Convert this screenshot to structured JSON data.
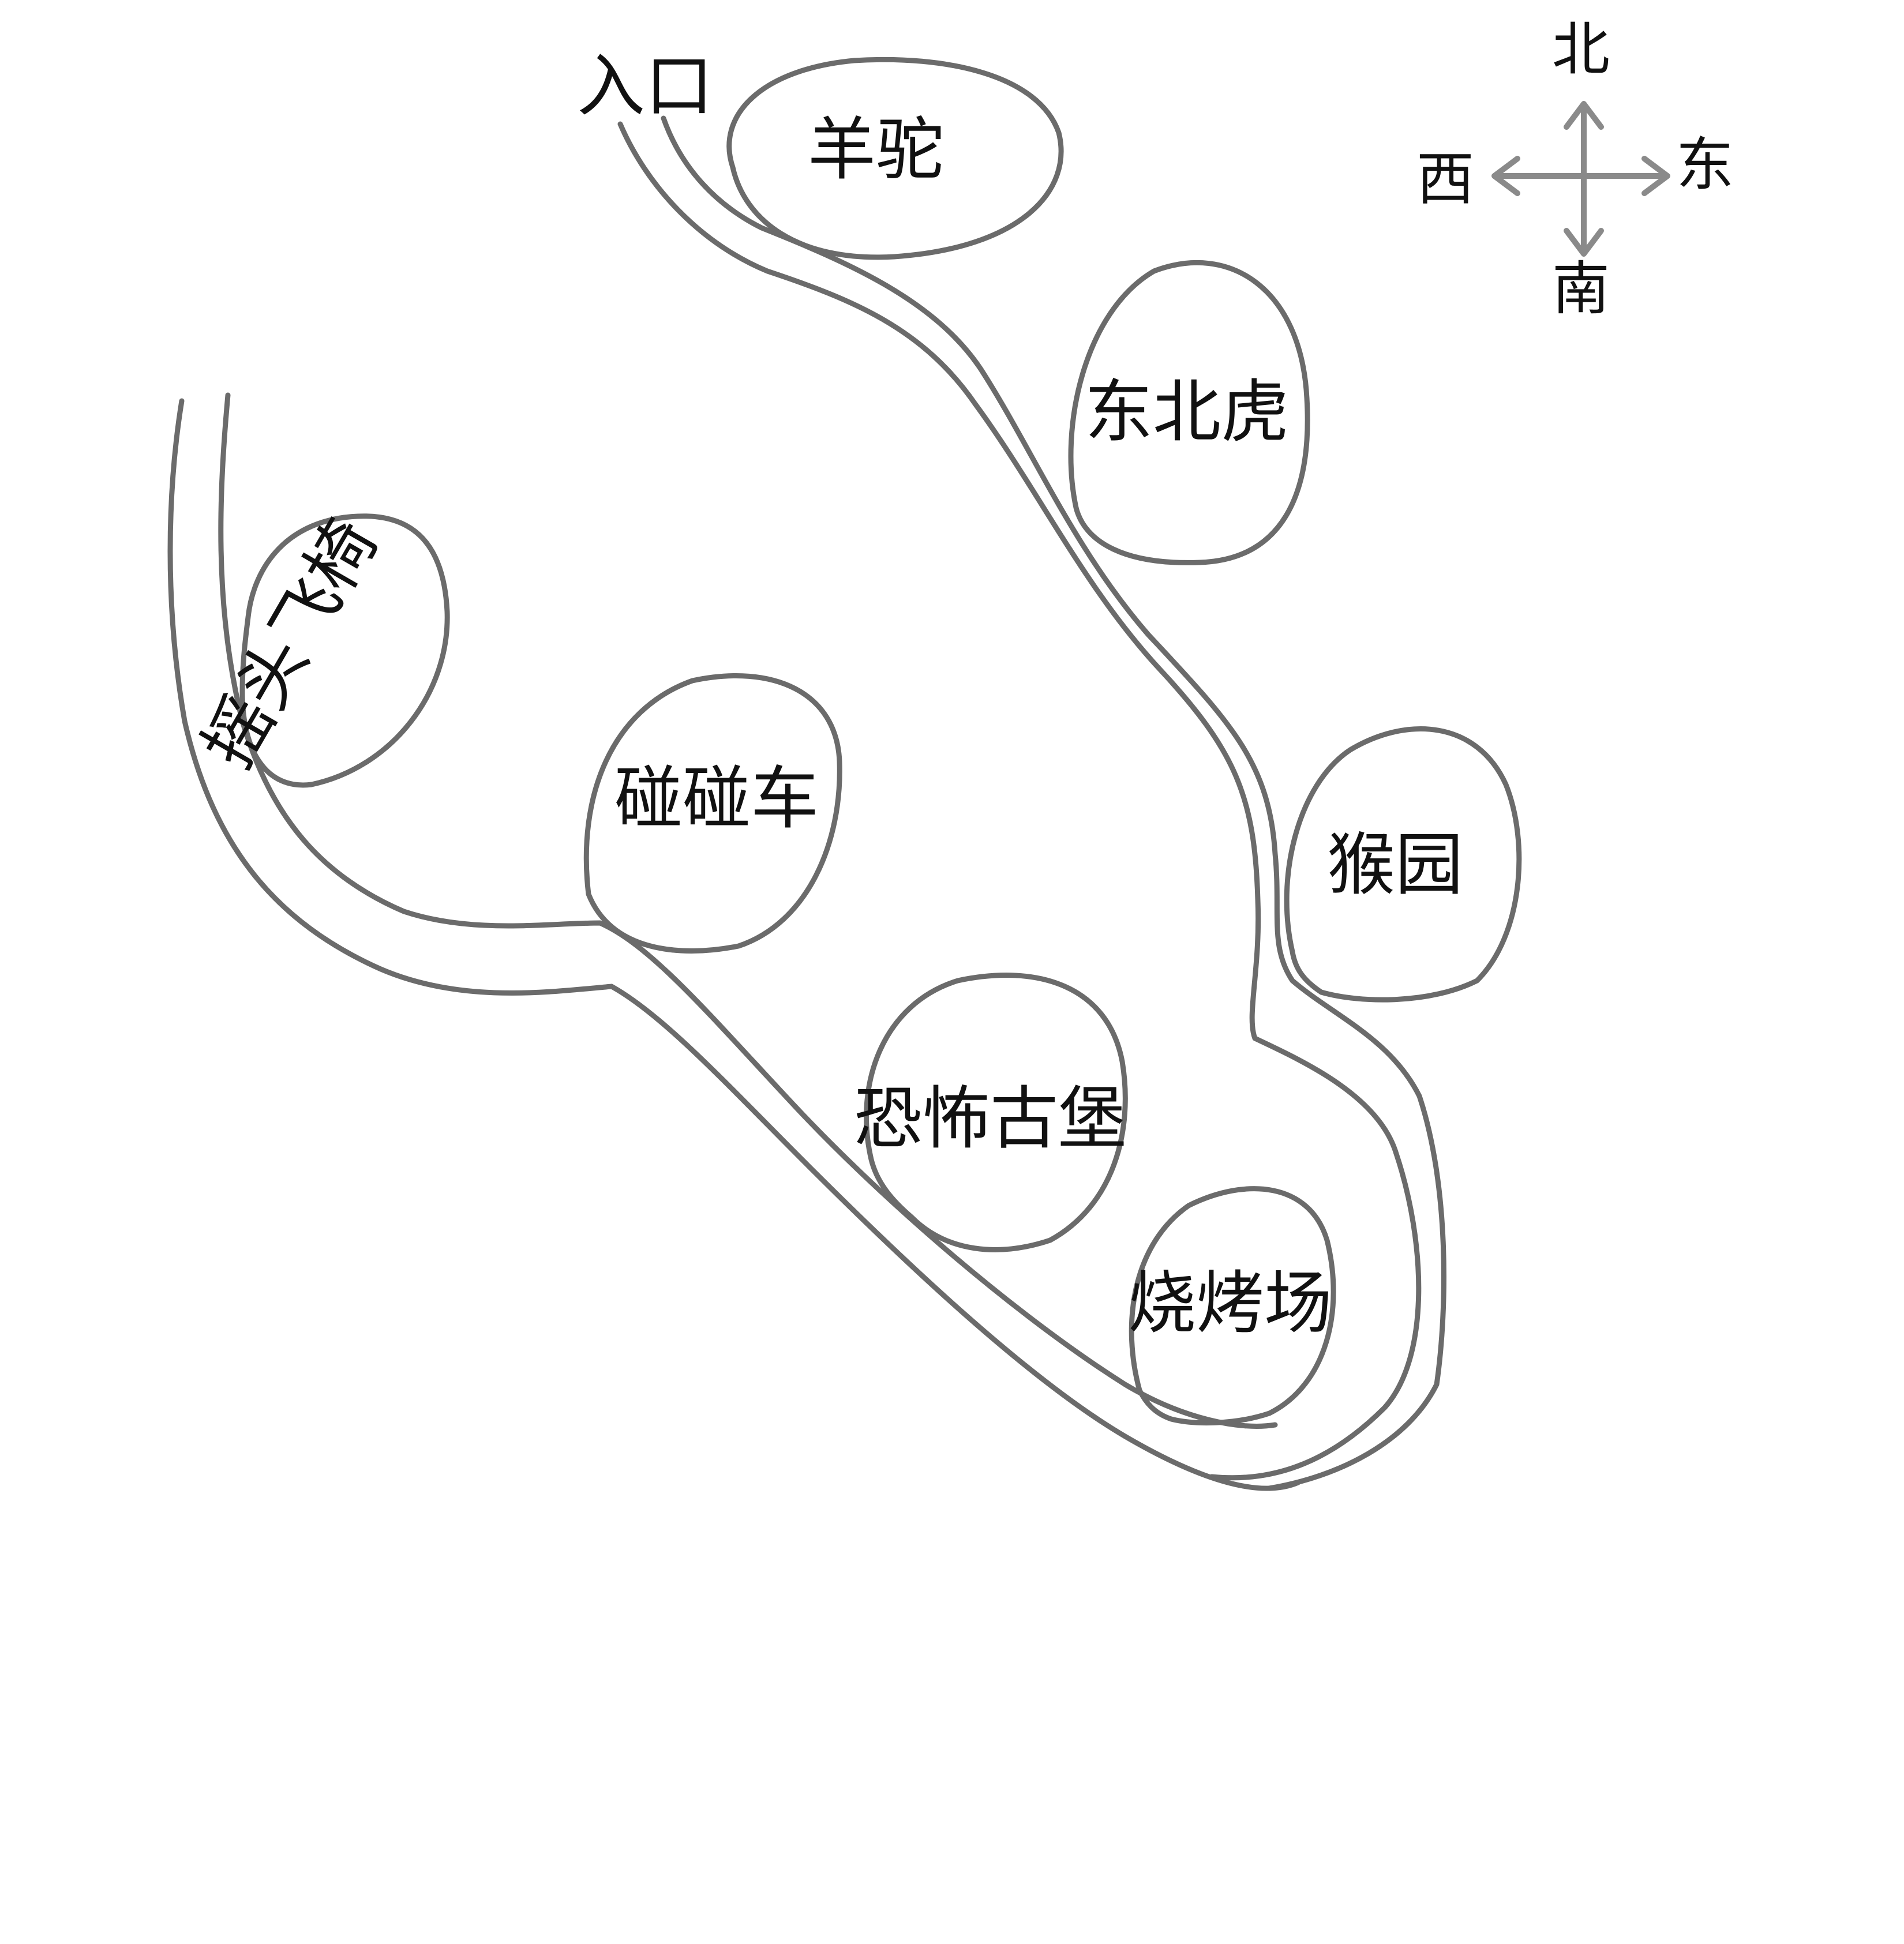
{
  "entrance_label": "入口",
  "attractions": [
    {
      "id": "alpaca",
      "label": "羊驼"
    },
    {
      "id": "tiger",
      "label": "东北虎"
    },
    {
      "id": "swing-chair",
      "label": "摇头飞椅"
    },
    {
      "id": "bumper-car",
      "label": "碰碰车"
    },
    {
      "id": "monkey-park",
      "label": "猴园"
    },
    {
      "id": "haunted-castle",
      "label": "恐怖古堡"
    },
    {
      "id": "bbq",
      "label": "烧烤场"
    }
  ],
  "compass": {
    "north": "北",
    "south": "南",
    "east": "东",
    "west": "西"
  },
  "colors": {
    "ink": "#6b6b6b",
    "text": "#111111",
    "compass": "#8a8a8a"
  }
}
